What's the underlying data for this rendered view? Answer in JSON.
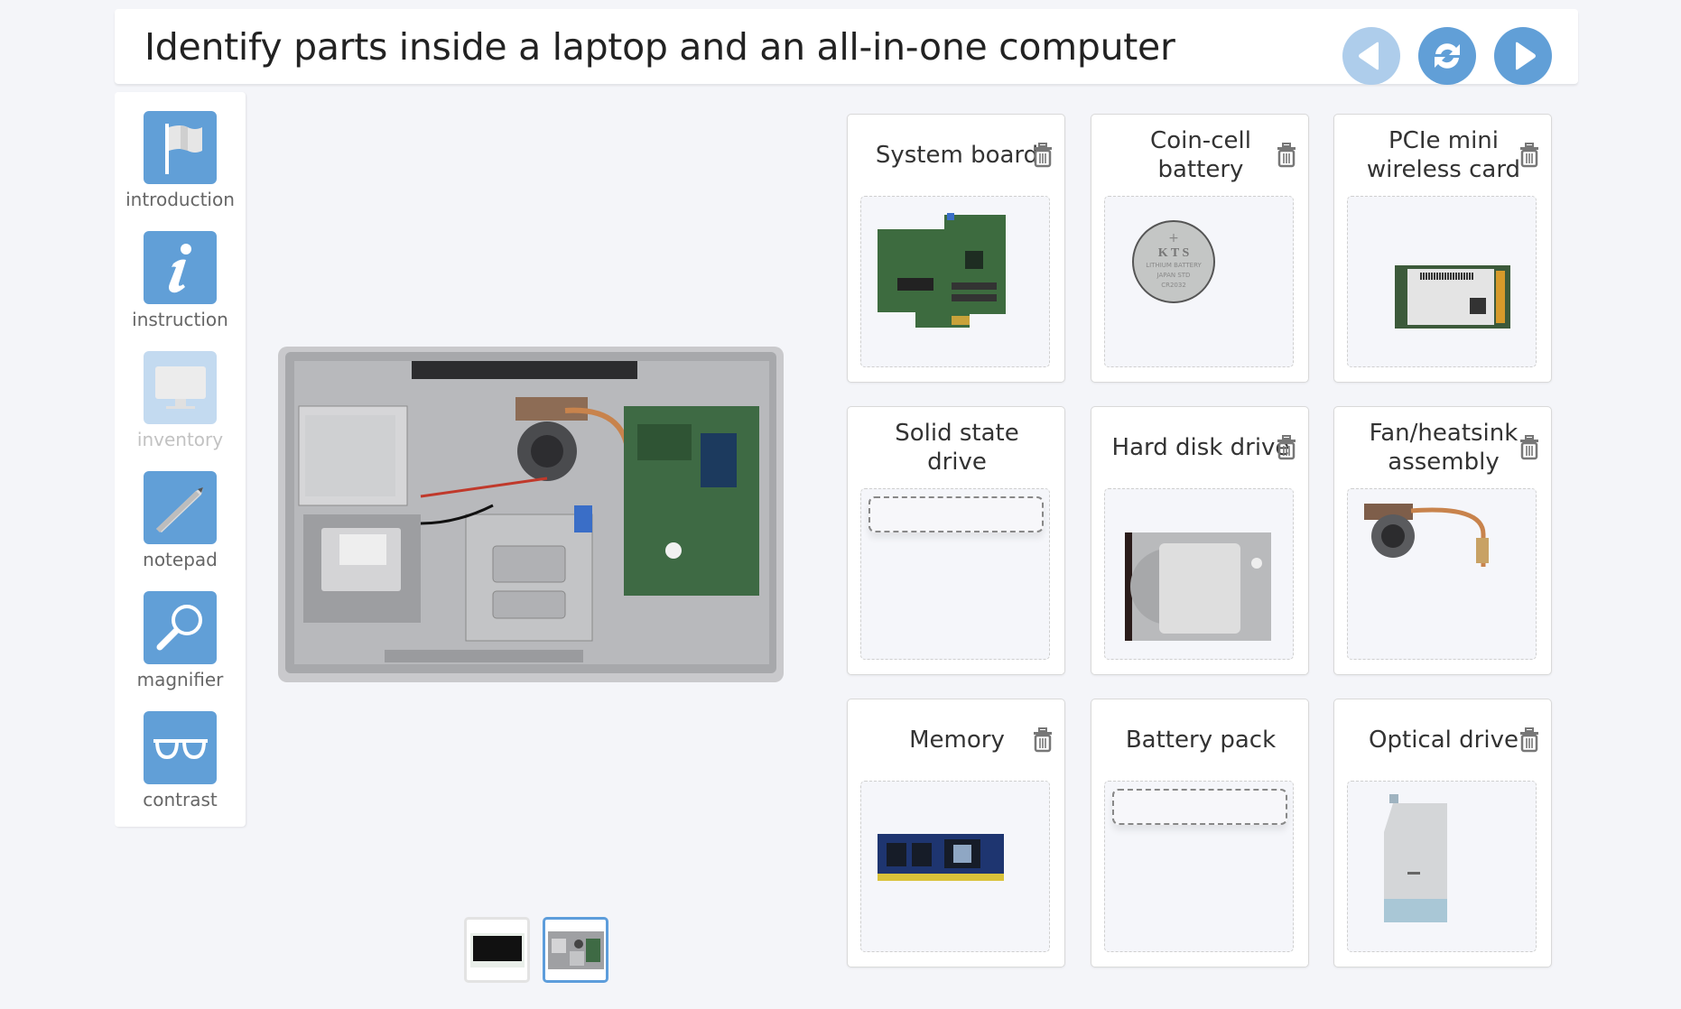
{
  "header": {
    "title": "Identify parts inside a laptop and an all-in-one computer",
    "nav": [
      {
        "name": "back",
        "icon": "arrow-left-icon",
        "enabled": false
      },
      {
        "name": "reset",
        "icon": "refresh-icon",
        "enabled": true
      },
      {
        "name": "next",
        "icon": "arrow-right-icon",
        "enabled": true
      }
    ]
  },
  "sidebar": {
    "items": [
      {
        "label": "introduction",
        "icon": "flag-icon",
        "enabled": true
      },
      {
        "label": "instruction",
        "icon": "info-icon",
        "enabled": true
      },
      {
        "label": "inventory",
        "icon": "monitor-icon",
        "enabled": false
      },
      {
        "label": "notepad",
        "icon": "pencil-icon",
        "enabled": true
      },
      {
        "label": "magnifier",
        "icon": "magnifier-icon",
        "enabled": true
      },
      {
        "label": "contrast",
        "icon": "glasses-icon",
        "enabled": true
      }
    ]
  },
  "viewer": {
    "thumbnails": [
      {
        "name": "all-in-one front",
        "selected": false
      },
      {
        "name": "all-in-one interior",
        "selected": true
      }
    ]
  },
  "cards": [
    {
      "label": "System board",
      "filled": true,
      "part": "system-board"
    },
    {
      "label": "Coin-cell battery",
      "filled": true,
      "part": "coin-cell-battery",
      "battery_text": [
        "+",
        "K T S",
        "LITHIUM BATTERY",
        "JAPAN STD",
        "CR2032"
      ]
    },
    {
      "label": "PCIe mini wireless card",
      "filled": true,
      "part": "wireless-card"
    },
    {
      "label": "Solid state drive",
      "filled": false
    },
    {
      "label": "Hard disk drive",
      "filled": true,
      "part": "hard-disk-drive"
    },
    {
      "label": "Fan/heatsink assembly",
      "filled": true,
      "part": "fan-heatsink"
    },
    {
      "label": "Memory",
      "filled": true,
      "part": "memory"
    },
    {
      "label": "Battery pack",
      "filled": false
    },
    {
      "label": "Optical drive",
      "filled": true,
      "part": "optical-drive"
    }
  ],
  "colors": {
    "accent": "#619fd7",
    "accent_disabled": "#aecdeb",
    "background": "#f4f5f9"
  }
}
